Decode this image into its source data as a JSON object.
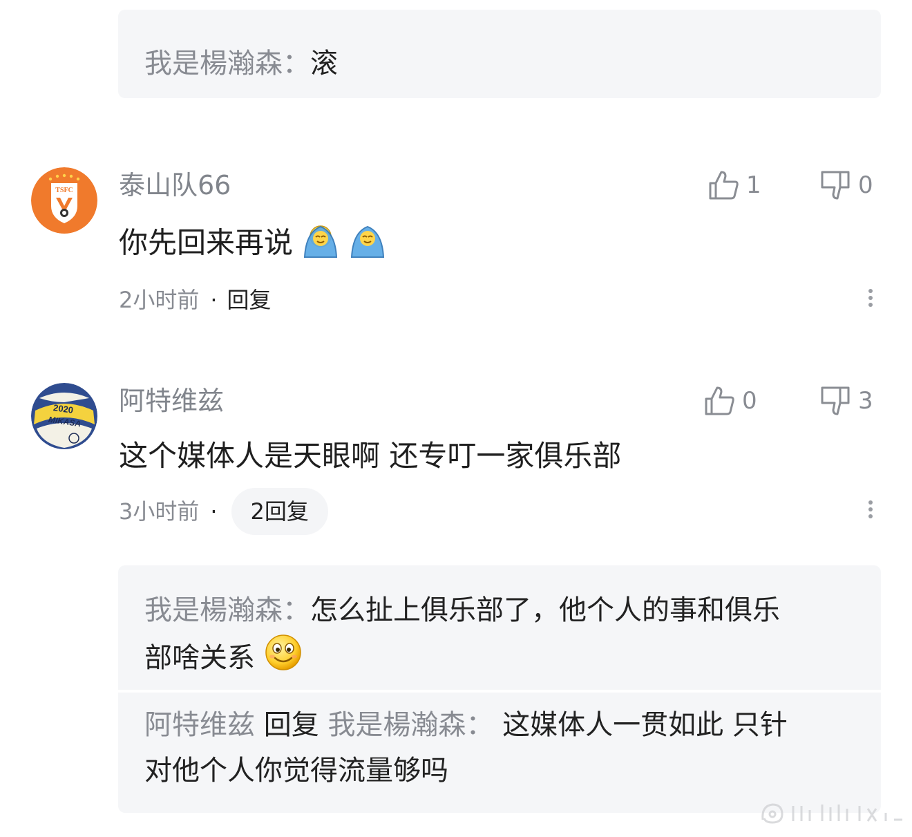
{
  "top_quote": {
    "author": "我是楊瀚森",
    "separator": "：",
    "text": "滚"
  },
  "comments": [
    {
      "username": "泰山队66",
      "avatar": "tsfc-club-logo",
      "content": "你先回来再说",
      "emojis": [
        "blanket-emoji",
        "blanket-emoji"
      ],
      "time": "2小时前",
      "dot": "·",
      "reply_label": "回复",
      "likes": "1",
      "dislikes": "0"
    },
    {
      "username": "阿特维兹",
      "avatar": "mikasa-volleyball",
      "content": "这个媒体人是天眼啊 还专叮一家俱乐部",
      "time": "3小时前",
      "dot": "·",
      "reply_label": "2回复",
      "likes": "0",
      "dislikes": "3",
      "replies": [
        {
          "author": "我是楊瀚森",
          "separator": "：",
          "line1": "怎么扯上俱乐部了，他个人的事和俱乐",
          "line2": "部啥关系",
          "emoji": "smile-emoji"
        },
        {
          "author": "阿特维兹",
          "reply_word": "回复",
          "target": "我是楊瀚森",
          "separator": "：",
          "line1": "这媒体人一贯如此 只针",
          "line2": "对他个人你觉得流量够吗"
        }
      ]
    }
  ],
  "icons": {
    "like": "thumbs-up-icon",
    "dislike": "thumbs-down-icon",
    "more": "more-vertical-icon"
  },
  "colors": {
    "club_orange": "#f07a2c",
    "quote_bg": "#f5f6f8",
    "muted_text": "#888b92"
  }
}
